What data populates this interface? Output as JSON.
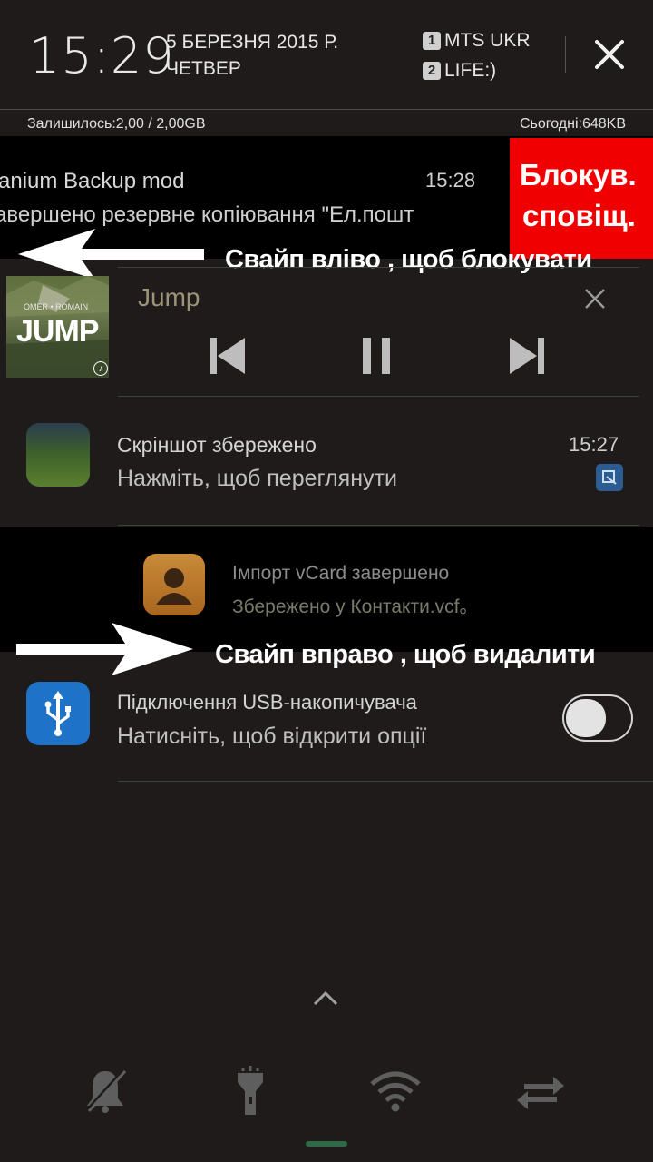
{
  "header": {
    "time": "15:29",
    "date_line1": "5 БЕРЕЗНЯ 2015 Р.",
    "date_line2": "ЧЕТВЕР",
    "sim1": {
      "num": "1",
      "operator": "MTS UKR"
    },
    "sim2": {
      "num": "2",
      "operator": "LIFE:)"
    },
    "close_icon": "close-icon"
  },
  "data_usage": {
    "remaining": "Залишилось:2,00 / 2,00GB",
    "today": "Сьогодні:648KB"
  },
  "notifications": {
    "titanium": {
      "title": "anium Backup mod",
      "time": "15:28",
      "text": "авершено резервне копіювання \"Ел.пошт"
    },
    "music": {
      "title": "Jump",
      "album_title": "JUMP",
      "album_artists": "OMER • ROMAIN",
      "controls": [
        "previous-icon",
        "pause-icon",
        "next-icon"
      ]
    },
    "screenshot": {
      "title": "Скріншот збережено",
      "time": "15:27",
      "text": "Нажміть, щоб переглянути"
    },
    "vcard": {
      "title": "Імпорт vCard завершено",
      "text": "Збережено у Контакти.vcf。"
    },
    "usb": {
      "title": "Підключення USB-накопичувача",
      "text": "Натисніть, щоб відкрити опції",
      "toggle_on": false
    }
  },
  "annotations": {
    "block_label_line1": "Блокув.",
    "block_label_line2": "сповіщ.",
    "swipe_left": "Свайп вліво , щоб блокувати",
    "swipe_right": "Свайп вправо , щоб видалити",
    "highlight_color": "#f00000"
  },
  "quick_settings": [
    "bell-muted-icon",
    "flashlight-icon",
    "wifi-icon",
    "data-sync-icon"
  ],
  "colors": {
    "background": "#201b1b",
    "divider": "#37453b",
    "handle": "#2c6b46",
    "usb_icon": "#1e73c9"
  }
}
